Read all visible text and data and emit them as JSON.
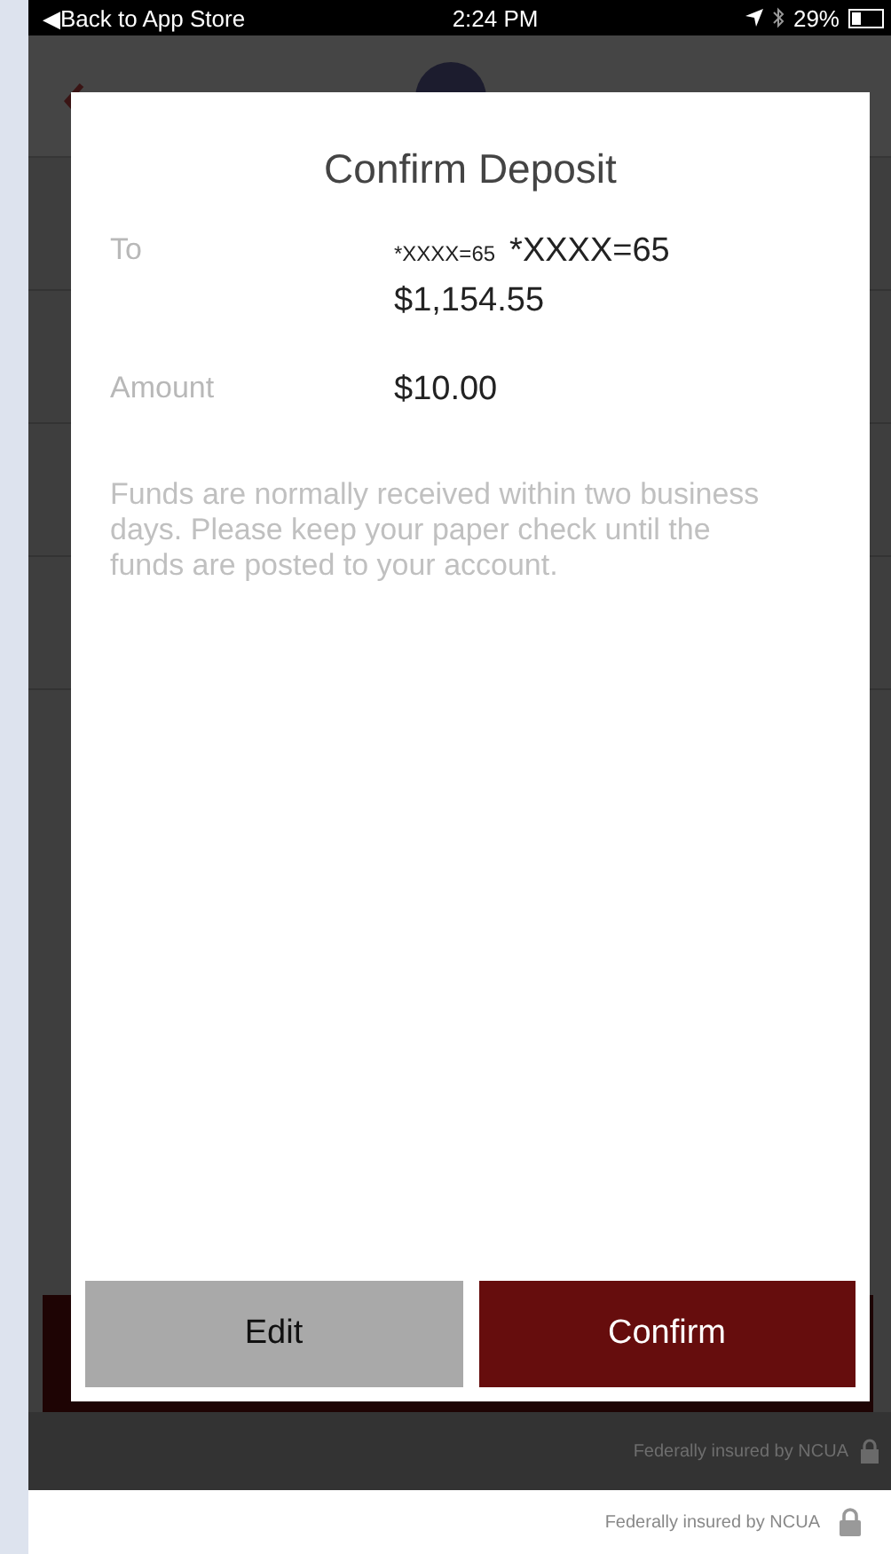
{
  "status_bar": {
    "back_label": "◀Back to App Store",
    "time": "2:24 PM",
    "battery": "29%"
  },
  "background": {
    "footer_note": "Federally insured by NCUA"
  },
  "dialog": {
    "title": "Confirm Deposit",
    "to": {
      "label": "To",
      "account_short": "*XXXX=65",
      "account": "*XXXX=65",
      "balance": "$1,154.55"
    },
    "amount": {
      "label": "Amount",
      "value": "$10.00"
    },
    "note": "Funds are normally received within two business days. Please keep your paper check until the funds are posted to your account.",
    "buttons": [
      {
        "label": "Edit",
        "kind": "secondary"
      },
      {
        "label": "Confirm",
        "kind": "primary"
      }
    ]
  },
  "footer": {
    "note": "Federally insured by NCUA"
  }
}
